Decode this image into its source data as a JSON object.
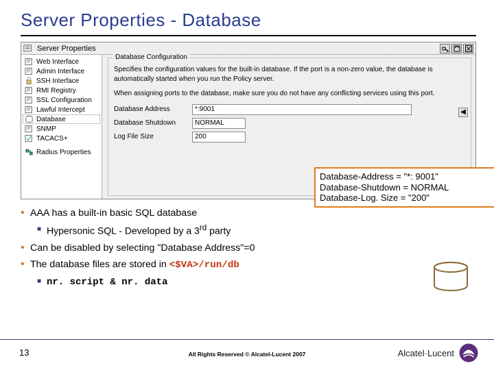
{
  "title": "Server Properties - Database",
  "window": {
    "title": "Server Properties",
    "tree": [
      {
        "label": "Web Interface",
        "icon": "doc"
      },
      {
        "label": "Admin Interface",
        "icon": "doc"
      },
      {
        "label": "SSH Interface",
        "icon": "lock"
      },
      {
        "label": "RMI Registry",
        "icon": "doc"
      },
      {
        "label": "SSL Configuration",
        "icon": "doc"
      },
      {
        "label": "Lawful Intercept",
        "icon": "doc"
      },
      {
        "label": "Database",
        "icon": "db",
        "selected": true
      },
      {
        "label": "SNMP",
        "icon": "doc"
      },
      {
        "label": "TACACS+",
        "icon": "check"
      },
      {
        "label": "Radius Properties",
        "icon": "node",
        "gap": true
      }
    ],
    "group_title": "Database Configuration",
    "desc1": "Specifies the configuration values for the built-in database. If the port is a non-zero value, the database is automatically started when you run the Policy server.",
    "desc2": "When assigning ports to the database, make sure you do not have any conflicting services using this port.",
    "fields": {
      "addr_label": "Database Address",
      "addr_value": "*:9001",
      "shut_label": "Database Shutdown",
      "shut_value": "NORMAL",
      "log_label": "Log File Size",
      "log_value": "200"
    }
  },
  "callout": {
    "l1": "Database-Address = \"*: 9001\"",
    "l2": "Database-Shutdown = NORMAL",
    "l3": "Database-Log. Size = \"200\""
  },
  "bullets": {
    "b1": "AAA has a built-in basic SQL database",
    "b2_pre": "Hypersonic SQL - Developed by a 3",
    "b2_sup": "rd",
    "b2_post": " party",
    "b3": "Can be disabled by selecting \"Database Address\"=0",
    "b4_pre": "The database files are stored in ",
    "b4_code": "<$VA>/run/db",
    "b5": "nr. script & nr. data"
  },
  "footer": {
    "page": "13",
    "copyright": "All Rights Reserved © Alcatel-Lucent 2007",
    "brand": "Alcatel·Lucent"
  }
}
